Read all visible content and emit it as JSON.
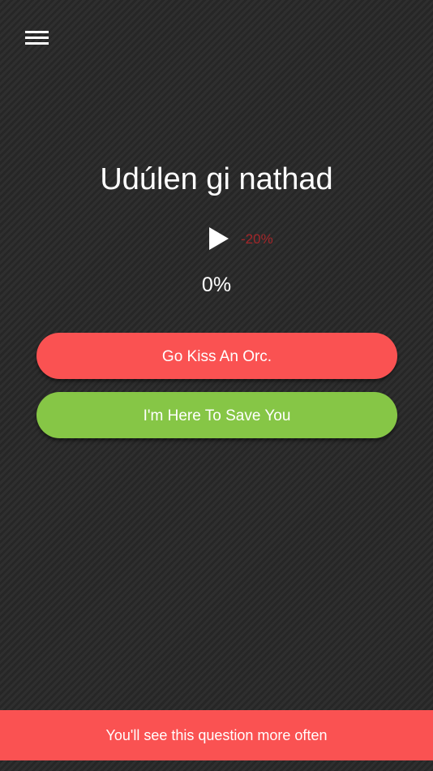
{
  "header": {
    "menu_icon": "hamburger-menu-icon"
  },
  "question": {
    "text": "Udúlen gi nathad"
  },
  "player": {
    "play_icon": "play-icon",
    "speed_label": "-20%",
    "speed_color": "#a3262a"
  },
  "progress": {
    "text": "0%"
  },
  "answers": [
    {
      "label": "Go Kiss An Orc.",
      "color": "#fa5252"
    },
    {
      "label": "I'm Here To Save You",
      "color": "#86c646"
    }
  ],
  "footer": {
    "message": "You'll see this question more often",
    "color": "#fa5252"
  }
}
